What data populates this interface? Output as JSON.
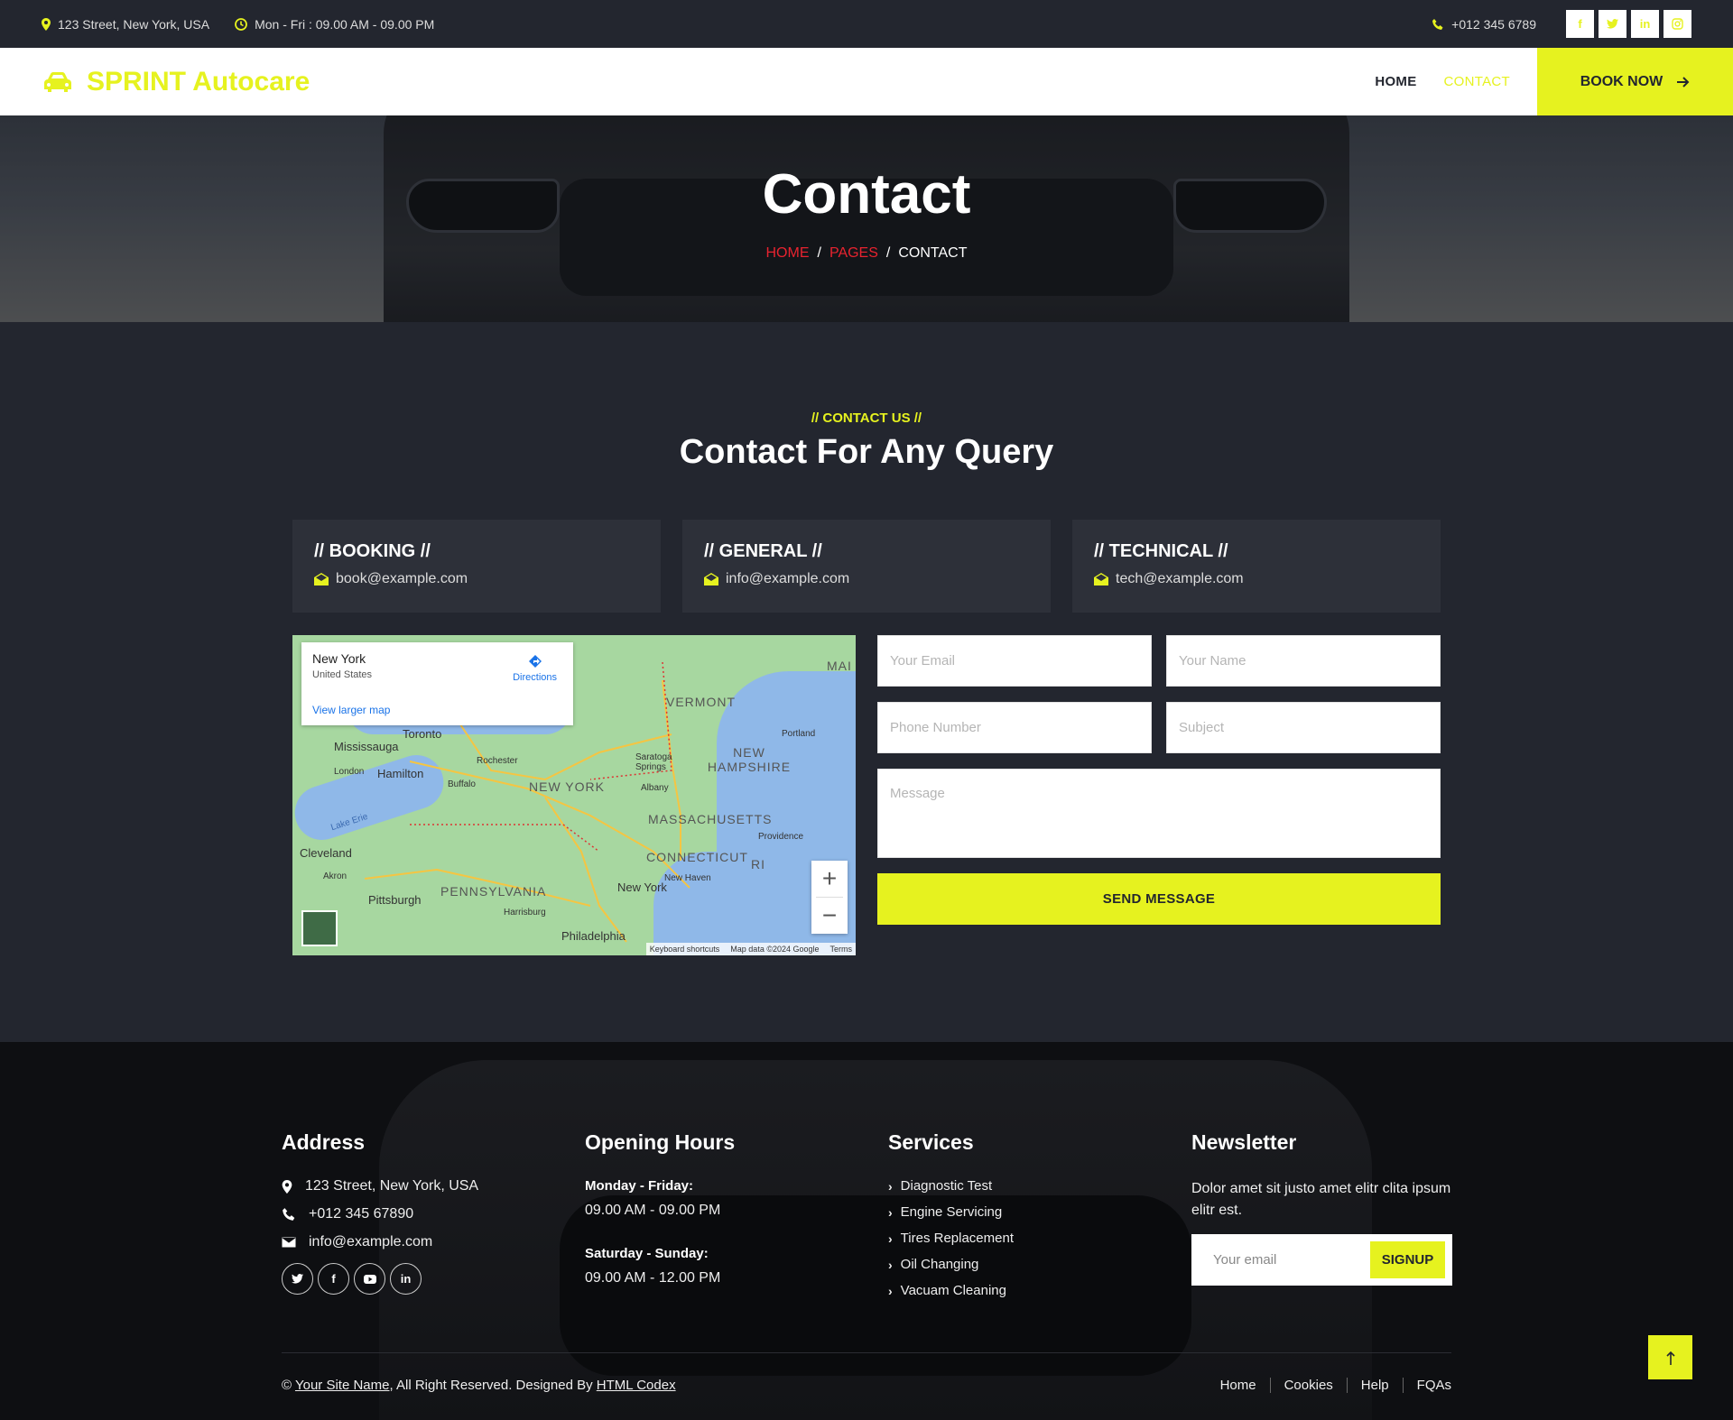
{
  "topbar": {
    "address": "123 Street, New York, USA",
    "hours": "Mon - Fri : 09.00 AM - 09.00 PM",
    "phone": "+012 345 6789",
    "social": [
      "f",
      "t",
      "in",
      "ig"
    ]
  },
  "navbar": {
    "brand": "SPRINT Autocare",
    "links": [
      "HOME",
      "CONTACT"
    ],
    "book_label": "BOOK NOW"
  },
  "hero": {
    "title": "Contact",
    "breadcrumb": [
      "HOME",
      "PAGES",
      "CONTACT"
    ]
  },
  "contact": {
    "label": "// CONTACT US //",
    "title": "Contact For Any Query",
    "cards": [
      {
        "title": "// BOOKING //",
        "email": "book@example.com"
      },
      {
        "title": "// GENERAL //",
        "email": "info@example.com"
      },
      {
        "title": "// TECHNICAL //",
        "email": "tech@example.com"
      }
    ]
  },
  "map": {
    "place": "New York",
    "country": "United States",
    "larger_link": "View larger map",
    "directions": "Directions",
    "labels": [
      "Toronto",
      "Mississauga",
      "London",
      "Hamilton",
      "Rochester",
      "Buffalo",
      "NEW YORK",
      "Albany",
      "VERMONT",
      "NEW HAMPSHIRE",
      "MASSACHUSETTS",
      "CONNECTICUT",
      "Providence",
      "RI",
      "Cleveland",
      "Akron",
      "Pittsburgh",
      "PENNSYLVANIA",
      "Harrisburg",
      "Philadelphia",
      "New York",
      "New Haven",
      "Portland",
      "Saratoga Springs",
      "Lake Erie",
      "MAI"
    ],
    "footer": [
      "Keyboard shortcuts",
      "Map data ©2024 Google",
      "Terms"
    ]
  },
  "form": {
    "email_placeholder": "Your Email",
    "name_placeholder": "Your Name",
    "phone_placeholder": "Phone Number",
    "subject_placeholder": "Subject",
    "message_placeholder": "Message",
    "send_label": "SEND MESSAGE"
  },
  "footer": {
    "address": {
      "title": "Address",
      "street": "123 Street, New York, USA",
      "phone": "+012 345 67890",
      "email": "info@example.com"
    },
    "hours": {
      "title": "Opening Hours",
      "weekday_label": "Monday - Friday:",
      "weekday_value": "09.00 AM - 09.00 PM",
      "weekend_label": "Saturday - Sunday:",
      "weekend_value": "09.00 AM - 12.00 PM"
    },
    "services": {
      "title": "Services",
      "items": [
        "Diagnostic Test",
        "Engine Servicing",
        "Tires Replacement",
        "Oil Changing",
        "Vacuam Cleaning"
      ]
    },
    "newsletter": {
      "title": "Newsletter",
      "text": "Dolor amet sit justo amet elitr clita ipsum elitr est.",
      "placeholder": "Your email",
      "button": "SIGNUP"
    },
    "copyright_prefix": "©",
    "site_name": "Your Site Name",
    "copyright_mid": ", All Right Reserved. Designed By",
    "designer": "HTML Codex",
    "links": [
      "Home",
      "Cookies",
      "Help",
      "FQAs"
    ]
  },
  "colors": {
    "accent": "#e6f21f",
    "dark": "#23262f",
    "breadcrumb_link": "#e8232f"
  }
}
